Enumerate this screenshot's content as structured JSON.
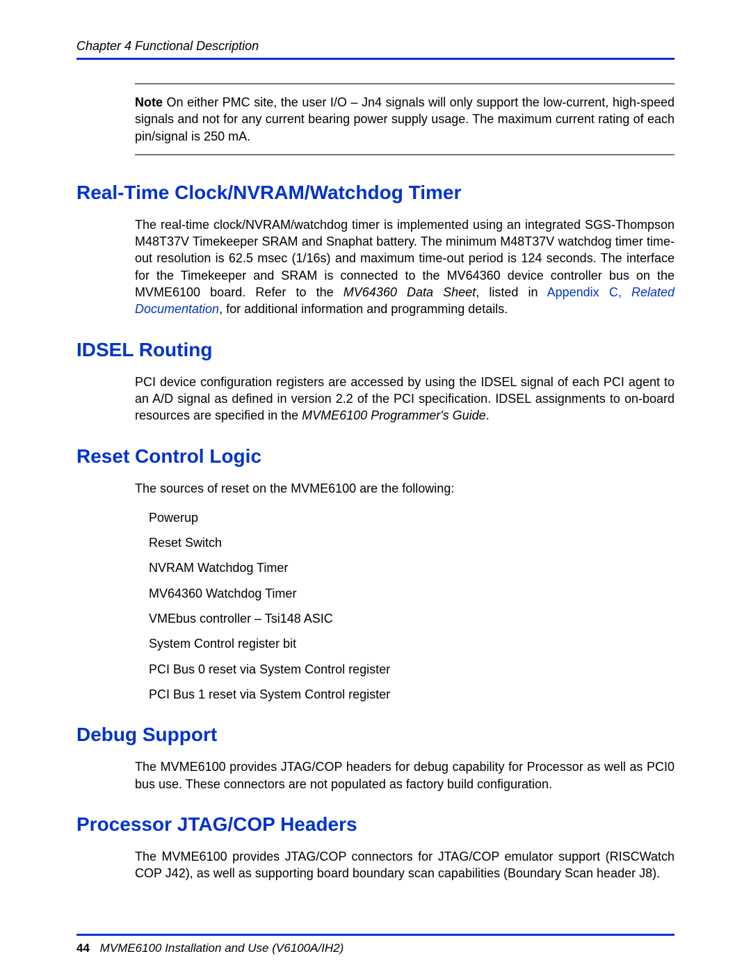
{
  "header": {
    "chapter": "Chapter 4  Functional Description"
  },
  "note": {
    "label": "Note",
    "text": "  On either PMC site, the user I/O – Jn4 signals will only support the low-current, high-speed signals and not for any current bearing power supply usage. The maximum current rating of each pin/signal is 250 mA."
  },
  "sections": {
    "rtc": {
      "heading": "Real-Time Clock/NVRAM/Watchdog Timer",
      "body_1": "The real-time clock/NVRAM/watchdog timer is implemented using an integrated SGS-Thompson M48T37V Timekeeper SRAM and Snaphat battery. The minimum M48T37V watchdog timer time-out resolution is 62.5 msec (1/16s) and maximum time-out period is 124 seconds. The interface for the Timekeeper and SRAM is connected to the MV64360 device controller bus on the MVME6100 board. Refer to the ",
      "italic_1": "MV64360 Data Sheet",
      "body_2": ", listed in ",
      "link_1": "Appendix C, ",
      "link_italic": "Related Documentation",
      "body_3": ", for additional information and programming details."
    },
    "idsel": {
      "heading": "IDSEL Routing",
      "body_1": "PCI device configuration registers are accessed by using the IDSEL signal of each PCI agent to an A/D signal as defined in version 2.2 of the PCI specification. IDSEL assignments to on-board resources are specified in the ",
      "italic_1": "MVME6100 Programmer's Guide",
      "body_2": "."
    },
    "reset": {
      "heading": "Reset Control Logic",
      "intro": "The sources of reset on the MVME6100 are the following:",
      "items": [
        "Powerup",
        "Reset Switch",
        "NVRAM Watchdog Timer",
        "MV64360 Watchdog Timer",
        "VMEbus controller – Tsi148 ASIC",
        "System Control register bit",
        "PCI Bus 0 reset via System Control register",
        "PCI Bus 1 reset via System Control register"
      ]
    },
    "debug": {
      "heading": "Debug Support",
      "body": "The MVME6100 provides JTAG/COP headers for debug capability for Processor as well as PCI0 bus use. These connectors are not populated as factory build configuration."
    },
    "jtag": {
      "heading": "Processor JTAG/COP Headers",
      "body": "The MVME6100 provides JTAG/COP connectors for JTAG/COP emulator support (RISCWatch COP J42), as well as supporting board boundary scan capabilities (Boundary Scan header J8)."
    }
  },
  "footer": {
    "page_number": "44",
    "title": "MVME6100 Installation and Use (V6100A/IH2)"
  }
}
